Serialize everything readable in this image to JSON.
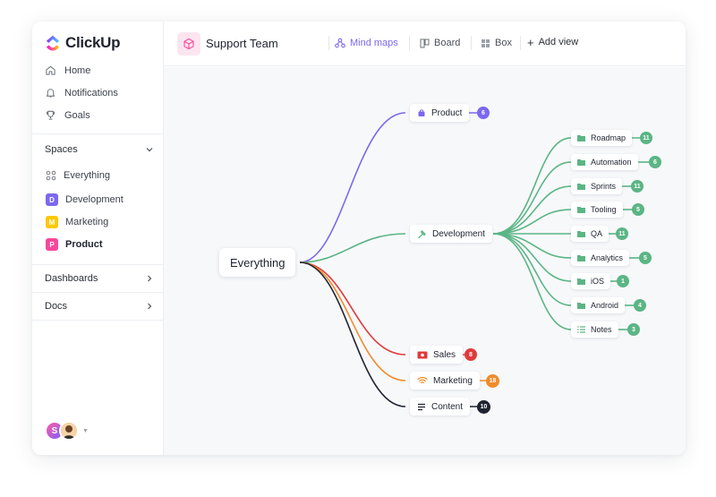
{
  "brand": {
    "name": "ClickUp"
  },
  "sidebar": {
    "nav": [
      {
        "label": "Home",
        "icon": "home-icon"
      },
      {
        "label": "Notifications",
        "icon": "bell-icon"
      },
      {
        "label": "Goals",
        "icon": "trophy-icon"
      }
    ],
    "spaces_label": "Spaces",
    "spaces": [
      {
        "label": "Everything",
        "badge": "",
        "color": ""
      },
      {
        "label": "Development",
        "badge": "D",
        "color": "#7b68ee"
      },
      {
        "label": "Marketing",
        "badge": "M",
        "color": "#ffc800"
      },
      {
        "label": "Product",
        "badge": "P",
        "color": "#f7479a"
      }
    ],
    "dashboards_label": "Dashboards",
    "docs_label": "Docs",
    "avatar_initial": "S"
  },
  "topbar": {
    "workspace_title": "Support Team",
    "views": [
      {
        "label": "Mind maps",
        "active": true
      },
      {
        "label": "Board",
        "active": false
      },
      {
        "label": "Box",
        "active": false
      }
    ],
    "add_view_label": "Add view"
  },
  "mindmap": {
    "root": "Everything",
    "branches": [
      {
        "label": "Product",
        "count": "6",
        "color": "#7b68ee"
      },
      {
        "label": "Development",
        "count": "",
        "color": "#5bb585"
      },
      {
        "label": "Sales",
        "count": "8",
        "color": "#e03a3a"
      },
      {
        "label": "Marketing",
        "count": "18",
        "color": "#f08c2a"
      },
      {
        "label": "Content",
        "count": "10",
        "color": "#1f2330"
      }
    ],
    "dev_children": [
      {
        "label": "Roadmap",
        "count": "11"
      },
      {
        "label": "Automation",
        "count": "6"
      },
      {
        "label": "Sprints",
        "count": "11"
      },
      {
        "label": "Tooling",
        "count": "5"
      },
      {
        "label": "QA",
        "count": "11"
      },
      {
        "label": "Analytics",
        "count": "5"
      },
      {
        "label": "iOS",
        "count": "1"
      },
      {
        "label": "Android",
        "count": "4"
      },
      {
        "label": "Notes",
        "count": "3"
      }
    ],
    "dev_color": "#5bb585"
  }
}
